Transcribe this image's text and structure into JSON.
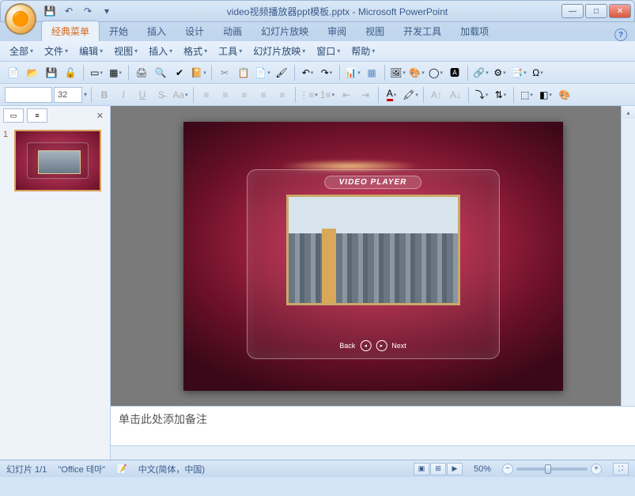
{
  "window": {
    "filename": "video视频播放器ppt模板.pptx",
    "app": "Microsoft PowerPoint"
  },
  "qat": {
    "save": "💾",
    "undo": "↶",
    "redo": "↷",
    "dd": "▾"
  },
  "ribbon_tabs": [
    "经典菜单",
    "开始",
    "插入",
    "设计",
    "动画",
    "幻灯片放映",
    "审阅",
    "视图",
    "开发工具",
    "加载项"
  ],
  "ribbon_active": 0,
  "menus": [
    "全部",
    "文件",
    "编辑",
    "视图",
    "插入",
    "格式",
    "工具",
    "幻灯片放映",
    "窗口",
    "帮助"
  ],
  "toolbar2": {
    "font": "",
    "font_size": "32"
  },
  "slide_panel": {
    "current": "1",
    "close": "✕"
  },
  "slide_content": {
    "player_label": "VIDEO PLAYER",
    "back": "Back",
    "next": "Next"
  },
  "notes_placeholder": "单击此处添加备注",
  "status": {
    "slide_count": "幻灯片 1/1",
    "theme": "\"Office 테마\"",
    "lang": "中文(简体，中国)",
    "zoom": "50%"
  },
  "colors": {
    "accent": "#d56a1a",
    "slide_bg_outer": "#3a0818",
    "slide_bg_inner": "#e0527a"
  }
}
